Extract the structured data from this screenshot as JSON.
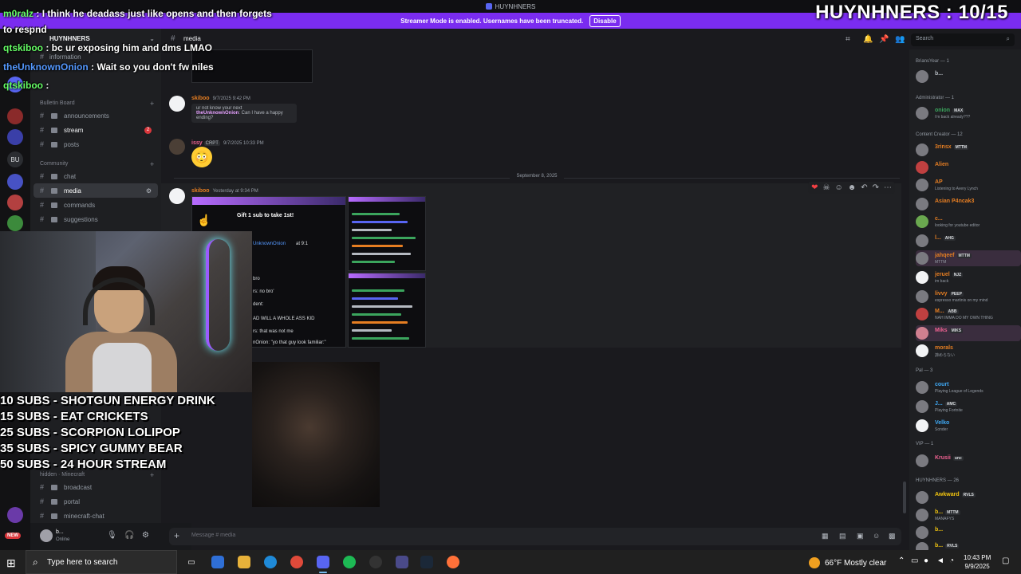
{
  "window": {
    "title": "HUYNHNERS"
  },
  "banner": {
    "text": "Streamer Mode is enabled. Usernames have been truncated.",
    "disable_label": "Disable"
  },
  "overlay": {
    "counter": "HUYNHNERS : 10/15"
  },
  "chat_overlay": [
    {
      "name": "m0ralz",
      "text": " : I think he deadass just like opens and then forgets",
      "cont": "to respnd"
    },
    {
      "name": "qtskiboo",
      "text": " : bc ur exposing him and dms LMAO"
    },
    {
      "name": "theUnknownOnion",
      "text": " : Wait so you don't fw niles"
    },
    {
      "name": "qtskiboo",
      "text": " : "
    }
  ],
  "sub_goals": [
    "10 SUBS - SHOTGUN ENERGY DRINK",
    "15 SUBS - EAT CRICKETS",
    "25 SUBS - SCORPION LOLIPOP",
    "35 SUBS - SPICY GUMMY BEAR",
    "50 SUBS - 24 HOUR STREAM"
  ],
  "servers": {
    "bu_label": "BU",
    "new_badge": "NEW"
  },
  "sidebar": {
    "server_name": "HUYNHNERS",
    "info_channel": "information",
    "cat_bulletin": "Bulletin Board",
    "cat_community": "Community",
    "cat_minecraft": "Minecraft",
    "channels": {
      "announcements": "announcements",
      "stream": "stream",
      "stream_badge": "2",
      "posts": "posts",
      "chat": "chat",
      "media": "media",
      "commands": "commands",
      "suggestions": "suggestions",
      "broadcast": "broadcast",
      "portal": "portal",
      "minecraft_chat": "minecraft-chat"
    },
    "hidden_label": "hidden"
  },
  "user_panel": {
    "name": "b...",
    "status": "Online"
  },
  "header": {
    "channel": "media",
    "search_placeholder": "Search"
  },
  "messages": {
    "m1": {
      "author": "skiboo",
      "time": "9/7/2025 9:42 PM",
      "reply_name": "theUnknownOnion",
      "reply_text": "Can I have a happy ending?",
      "reply_sub": "ur not know your next"
    },
    "m2": {
      "author": "issy",
      "tag": "CRPT",
      "time": "9/7/2025 10:33 PM"
    },
    "date_divider": "September 8, 2025",
    "m3": {
      "author": "skiboo",
      "time": "Yesterday at 9:34 PM",
      "shot_title": "Gift 1 sub to take 1st!",
      "shot_name": "UnknownOnion",
      "shot_time": "at 9:1",
      "shot_lines": [
        "bro",
        "rs: no bro'",
        "dent:",
        "AD WILL A WHOLE ASS KID",
        "rs: that was not me",
        "nOnion: \"yo that guy look familiar:\""
      ]
    }
  },
  "input": {
    "placeholder": "Message #  media"
  },
  "members": {
    "groups": [
      {
        "label": "BriansYear — 1"
      },
      {
        "label": "Administrator — 1"
      },
      {
        "label": "Content Creator — 12"
      },
      {
        "label": "Pal — 3"
      },
      {
        "label": "VIP — 1"
      },
      {
        "label": "HUYNHNERS — 26"
      }
    ],
    "list": [
      {
        "name": "b...",
        "color": "#b5bac1",
        "sub": ""
      },
      {
        "name": "onion",
        "color": "#3ba55d",
        "tag": "MAX",
        "sub": "i'm back already???"
      },
      {
        "name": "3rinsx",
        "color": "#e67e22",
        "tag": "MTTM",
        "sub": ""
      },
      {
        "name": "Alien",
        "color": "#e67e22",
        "sub": ""
      },
      {
        "name": "AP",
        "color": "#e67e22",
        "sub": "Listening to Avery Lynch"
      },
      {
        "name": "Asian P4ncak3",
        "color": "#e67e22",
        "sub": ""
      },
      {
        "name": "c...",
        "color": "#e67e22",
        "sub": "looking for youtube editor"
      },
      {
        "name": "l...",
        "color": "#e67e22",
        "tag": "AHG",
        "sub": ""
      },
      {
        "name": "jahqeef",
        "color": "#e67e22",
        "tag": "MTTM",
        "sub": "MTTM"
      },
      {
        "name": "jeruel",
        "color": "#e67e22",
        "tag": "NJZ",
        "sub": "im back"
      },
      {
        "name": "livvy",
        "color": "#e67e22",
        "tag": "PEEP",
        "sub": "espresso martinis on my mind"
      },
      {
        "name": "M...",
        "color": "#e67e22",
        "tag": "ABB",
        "sub": "NAH IMMA DO MY OWN THING"
      },
      {
        "name": "Miks",
        "color": "#f06292",
        "tag": "MIKS",
        "sub": ""
      },
      {
        "name": "morals",
        "color": "#e67e22",
        "sub": "諦めらない"
      },
      {
        "name": "court",
        "color": "#3fa9f5",
        "sub": "Playing League of Legends"
      },
      {
        "name": "J...",
        "color": "#3fa9f5",
        "tag": "AMC",
        "sub": "Playing Fortnite"
      },
      {
        "name": "Velko",
        "color": "#3fa9f5",
        "sub": "Sonder"
      },
      {
        "name": "Krusii",
        "color": "#f06292",
        "tag": "unc",
        "sub": ""
      },
      {
        "name": "Awkward",
        "color": "#f1c40f",
        "tag": "RVLS",
        "sub": ""
      },
      {
        "name": "b...",
        "color": "#f1c40f",
        "tag": "MTTM",
        "sub": "MANAFYS"
      },
      {
        "name": "b...",
        "color": "#f1c40f",
        "sub": ""
      },
      {
        "name": "b...",
        "color": "#f1c40f",
        "tag": "RVLS",
        "sub": ""
      }
    ]
  },
  "taskbar": {
    "search_placeholder": "Type here to search",
    "weather": "66°F  Mostly clear",
    "time": "10:43 PM",
    "date": "9/9/2025"
  }
}
